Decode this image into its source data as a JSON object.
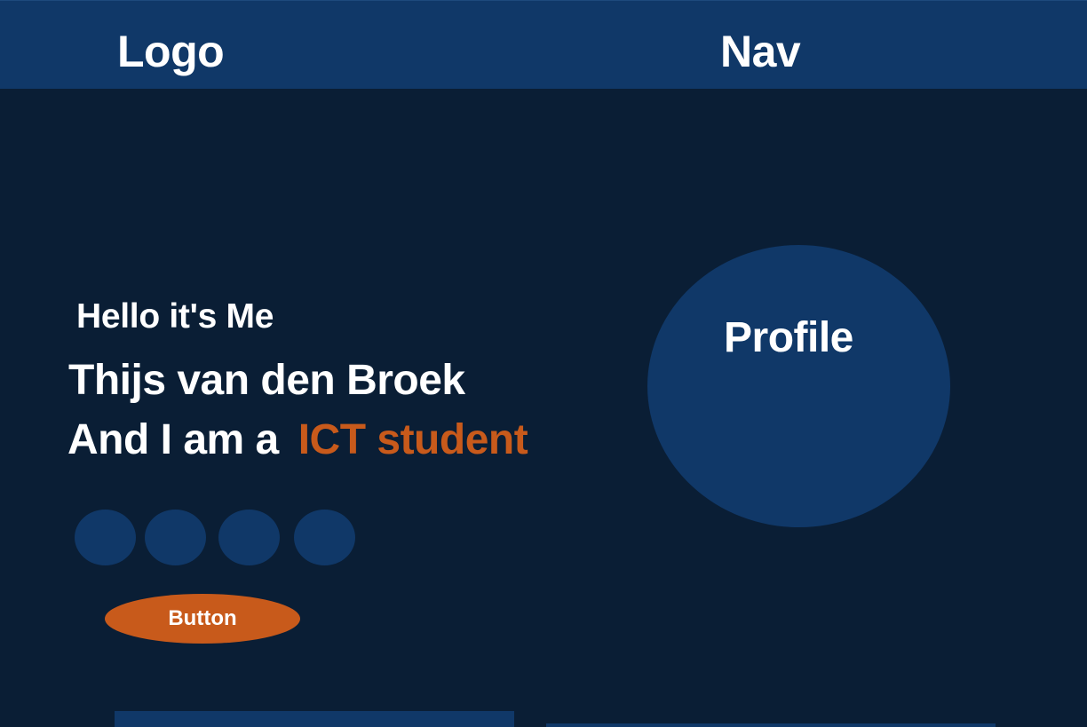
{
  "header": {
    "logo": "Logo",
    "nav": "Nav"
  },
  "hero": {
    "greeting": "Hello it's Me",
    "name": "Thijs van den Broek",
    "role_prefix": "And I am a",
    "role_highlight": "ICT student",
    "button_label": "Button"
  },
  "profile": {
    "label": "Profile"
  },
  "colors": {
    "background": "#0a1e35",
    "panel": "#103868",
    "accent": "#c85a1b",
    "text": "#ffffff"
  }
}
